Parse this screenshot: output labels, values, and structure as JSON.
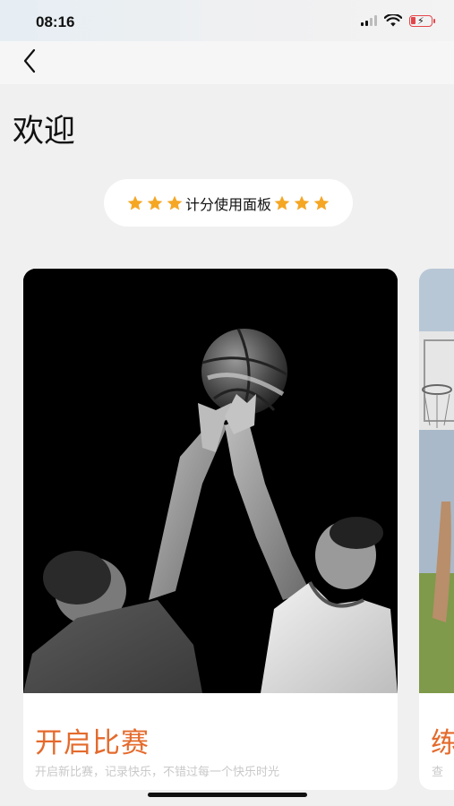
{
  "status_bar": {
    "time": "08:16",
    "icons": [
      "signal-icon",
      "wifi-icon",
      "battery-low-charging-icon"
    ],
    "battery_color": "#e3464a"
  },
  "nav": {
    "back_icon": "chevron-left-icon"
  },
  "page": {
    "title": "欢迎"
  },
  "banner": {
    "label": "计分使用面板",
    "star_color": "#f5a623"
  },
  "cards": [
    {
      "title": "开启比赛",
      "subtitle": "开启新比赛，记录快乐，不错过每一个快乐时光",
      "image": "basketball-jump-ball-photo"
    },
    {
      "title": "练",
      "subtitle": "查",
      "image": "basketball-hoop-photo"
    }
  ],
  "colors": {
    "accent": "#e46a2c",
    "background": "#f0f0f0"
  }
}
